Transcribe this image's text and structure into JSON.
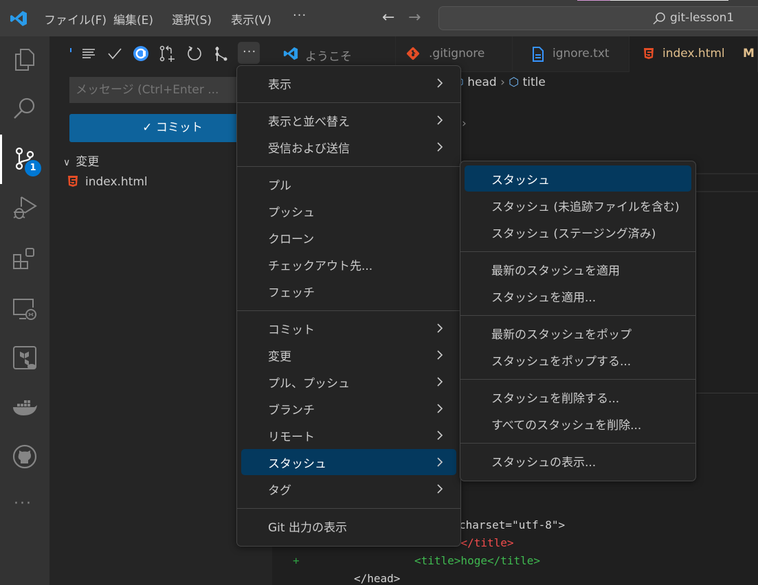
{
  "titlebar": {
    "menus": [
      "ファイル(F)",
      "編集(E)",
      "選択(S)",
      "表示(V)"
    ],
    "more_icon": "ellipsis-icon",
    "back_icon": "arrow-left-icon",
    "forward_icon": "arrow-right-icon",
    "search_text": "git-lesson1"
  },
  "activitybar": {
    "items": [
      {
        "name": "explorer",
        "icon": "files-icon"
      },
      {
        "name": "search",
        "icon": "search-icon"
      },
      {
        "name": "source-control",
        "icon": "source-control-icon",
        "active": true,
        "badge": "1"
      },
      {
        "name": "run-debug",
        "icon": "run-debug-icon"
      },
      {
        "name": "extensions",
        "icon": "extensions-icon"
      },
      {
        "name": "remote-explorer",
        "icon": "remote-explorer-icon"
      },
      {
        "name": "terraform",
        "icon": "terraform-icon"
      },
      {
        "name": "docker",
        "icon": "docker-icon"
      },
      {
        "name": "github",
        "icon": "github-icon"
      },
      {
        "name": "more",
        "icon": "ellipsis-icon"
      }
    ]
  },
  "sidebar": {
    "toolbar_icons": [
      "view-as-tree-icon",
      "commit-check-icon",
      "sync-icon",
      "pull-request-icon",
      "refresh-icon",
      "graph-icon",
      "more-actions-icon"
    ],
    "message_placeholder": "メッセージ (Ctrl+Enter ...",
    "commit_label": "✓ コミット",
    "changes_header": "変更",
    "files": [
      {
        "name": "index.html",
        "icon": "html5-icon"
      }
    ]
  },
  "tabs": [
    {
      "label": "ようこそ",
      "icon": "vscode-icon",
      "active": false
    },
    {
      "label": ".gitignore",
      "icon": "git-icon",
      "active": false
    },
    {
      "label": "ignore.txt",
      "icon": "text-file-icon",
      "active": false
    },
    {
      "label": "index.html",
      "icon": "html5-icon",
      "active": true,
      "status": "M"
    }
  ],
  "breadcrumbs": [
    "head",
    "title"
  ],
  "editor": {
    "lines": [
      {
        "text": "charset=\"utf-8\">",
        "kind": "context"
      },
      {
        "text": "<title></title>",
        "kind": "removed"
      },
      {
        "gutter": "+",
        "text": "<title>hoge</title>",
        "kind": "added"
      },
      {
        "text": "</head>",
        "kind": "context"
      }
    ]
  },
  "menu": {
    "items": [
      {
        "label": "表示",
        "submenu": true
      },
      {
        "sep": true
      },
      {
        "label": "表示と並べ替え",
        "submenu": true
      },
      {
        "label": "受信および送信",
        "submenu": true
      },
      {
        "sep": true
      },
      {
        "label": "プル"
      },
      {
        "label": "プッシュ"
      },
      {
        "label": "クローン"
      },
      {
        "label": "チェックアウト先..."
      },
      {
        "label": "フェッチ"
      },
      {
        "sep": true
      },
      {
        "label": "コミット",
        "submenu": true
      },
      {
        "label": "変更",
        "submenu": true
      },
      {
        "label": "プル、プッシュ",
        "submenu": true
      },
      {
        "label": "ブランチ",
        "submenu": true
      },
      {
        "label": "リモート",
        "submenu": true
      },
      {
        "label": "スタッシュ",
        "submenu": true,
        "selected": true
      },
      {
        "label": "タグ",
        "submenu": true
      },
      {
        "sep": true
      },
      {
        "label": "Git 出力の表示"
      }
    ]
  },
  "submenu": {
    "items": [
      {
        "label": "スタッシュ",
        "selected": true
      },
      {
        "label": "スタッシュ (未追跡ファイルを含む)"
      },
      {
        "label": "スタッシュ (ステージング済み)"
      },
      {
        "sep": true
      },
      {
        "label": "最新のスタッシュを適用"
      },
      {
        "label": "スタッシュを適用..."
      },
      {
        "sep": true
      },
      {
        "label": "最新のスタッシュをポップ"
      },
      {
        "label": "スタッシュをポップする..."
      },
      {
        "sep": true
      },
      {
        "label": "スタッシュを削除する..."
      },
      {
        "label": "すべてのスタッシュを削除..."
      },
      {
        "sep": true
      },
      {
        "label": "スタッシュの表示..."
      }
    ]
  }
}
